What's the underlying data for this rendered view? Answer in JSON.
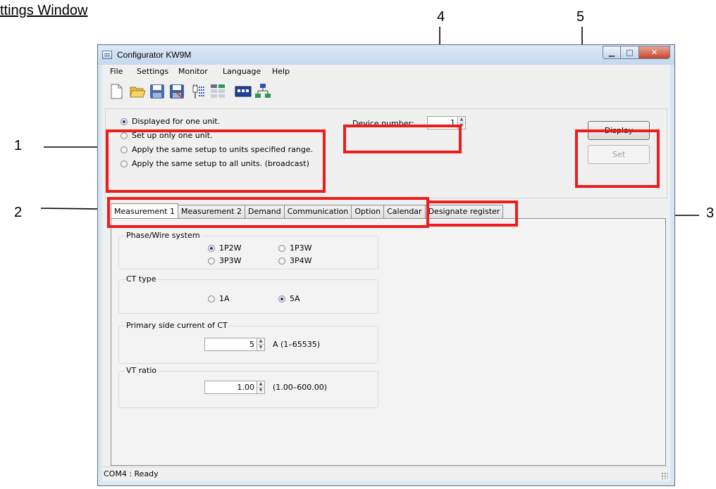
{
  "doc": {
    "title": "ttings Window"
  },
  "callouts": [
    "1",
    "2",
    "3",
    "4",
    "5"
  ],
  "window": {
    "title": "Configurator KW9M",
    "controls": [
      "minimize",
      "maximize",
      "close"
    ]
  },
  "menu": [
    "File",
    "Settings",
    "Monitor",
    "Language",
    "Help"
  ],
  "toolbar_icons": [
    "new-file-icon",
    "open-folder-icon",
    "save-icon",
    "save-as-icon",
    "connect-icon",
    "register-list-icon",
    "device-display-icon",
    "network-icon"
  ],
  "settings": {
    "mode_options": [
      "Displayed for one unit.",
      "Set up only one unit.",
      "Apply the same setup to units specified range.",
      "Apply the same setup to all units. (broadcast)"
    ],
    "selected_mode": 0,
    "device_number_label": "Device number:",
    "device_number": "1",
    "display_button": "Display",
    "set_button": "Set",
    "set_enabled": false
  },
  "tabs": [
    "Measurement 1",
    "Measurement 2",
    "Demand",
    "Communication",
    "Option",
    "Calendar",
    "Designate register"
  ],
  "active_tab": 0,
  "measurement1": {
    "phase_wire": {
      "label": "Phase/Wire system",
      "options": [
        "1P2W",
        "1P3W",
        "3P3W",
        "3P4W"
      ],
      "selected": "1P2W"
    },
    "ct_type": {
      "label": "CT type",
      "options": [
        "1A",
        "5A"
      ],
      "selected": "5A"
    },
    "primary_ct": {
      "label": "Primary side current of CT",
      "value": "5",
      "range": "A (1–65535)"
    },
    "vt_ratio": {
      "label": "VT ratio",
      "value": "1.00",
      "range": "(1.00–600.00)"
    }
  },
  "status": {
    "text": "COM4 : Ready"
  },
  "colors": {
    "highlight": "#ee1c1c",
    "window_frame": "#dbe6f3",
    "close_button": "#c8452c"
  }
}
